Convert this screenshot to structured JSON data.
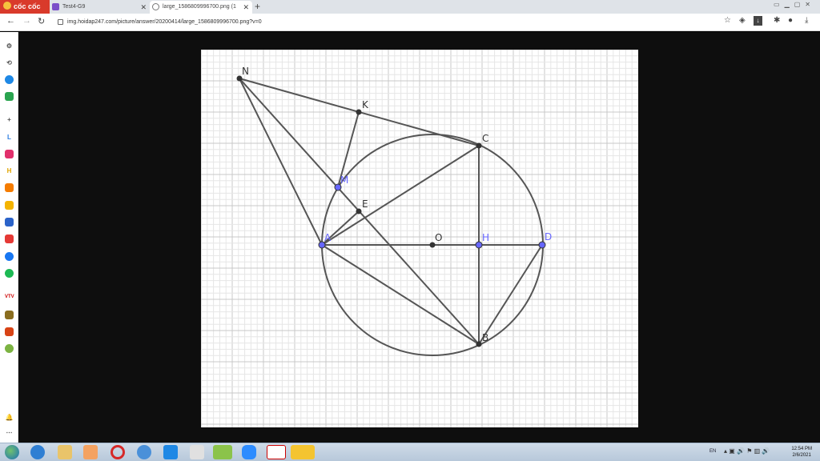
{
  "browser": {
    "brand": "cốc cốc",
    "tabs": [
      {
        "title": "Test4-G9"
      },
      {
        "title": "large_1586809996700.png (1"
      }
    ],
    "new_tab": "+",
    "url": "img.hoidap247.com/picture/answer/20200414/large_1586809996700.png?v=0"
  },
  "figure": {
    "labels": {
      "N": "N",
      "K": "K",
      "C": "C",
      "M": "M",
      "E": "E",
      "A": "A",
      "O": "O",
      "H": "H",
      "D": "D",
      "B": "B"
    },
    "colors": {
      "segment": "#555555",
      "point": "#333333",
      "blue_point": "#6666ff",
      "grid_major": "#c8c8c8",
      "grid_minor": "#e6e6e6"
    }
  },
  "taskbar": {
    "language": "EN",
    "time": "12:54 PM",
    "date": "2/6/2021"
  }
}
